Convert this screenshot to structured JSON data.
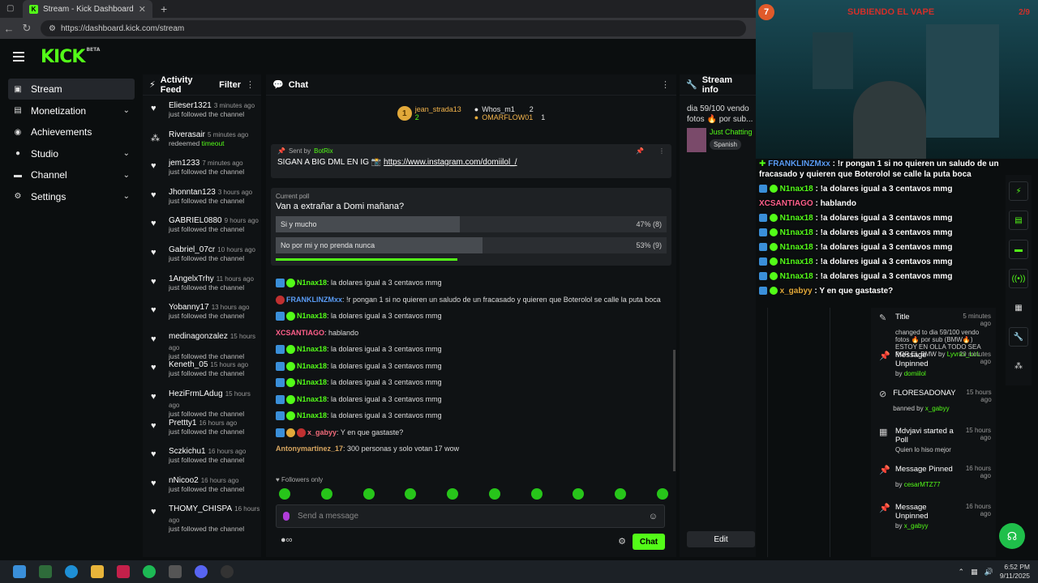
{
  "browser": {
    "tab_title": "Stream - Kick Dashboard",
    "url": "https://dashboard.kick.com/stream"
  },
  "header": {
    "logo": "KICK",
    "logo_badge": "BETA"
  },
  "sidebar": {
    "items": [
      {
        "label": "Stream",
        "icon": "stream-icon",
        "active": true
      },
      {
        "label": "Monetization",
        "icon": "monetization-icon",
        "chevron": true
      },
      {
        "label": "Achievements",
        "icon": "achievements-icon"
      },
      {
        "label": "Studio",
        "icon": "studio-icon",
        "chevron": true
      },
      {
        "label": "Channel",
        "icon": "channel-icon",
        "chevron": true
      },
      {
        "label": "Settings",
        "icon": "settings-icon",
        "chevron": true
      }
    ]
  },
  "activity": {
    "title": "Activity Feed",
    "filter": "Filter",
    "items": [
      {
        "user": "Elieser1321",
        "time": "3 minutes ago",
        "action": "just followed the channel"
      },
      {
        "user": "Riverasair",
        "time": "5 minutes ago",
        "action": "redeemed",
        "extra": "timeout"
      },
      {
        "user": "jem1233",
        "time": "7 minutes ago",
        "action": "just followed the channel"
      },
      {
        "user": "Jhonntan123",
        "time": "3 hours ago",
        "action": "just followed the channel"
      },
      {
        "user": "GABRIEL0880",
        "time": "9 hours ago",
        "action": "just followed the channel"
      },
      {
        "user": "Gabriel_07cr",
        "time": "10 hours ago",
        "action": "just followed the channel"
      },
      {
        "user": "1AngelxTrhy",
        "time": "11 hours ago",
        "action": "just followed the channel"
      },
      {
        "user": "Yobanny17",
        "time": "13 hours ago",
        "action": "just followed the channel"
      },
      {
        "user": "medinagonzalez",
        "time": "15 hours ago",
        "action": "just followed the channel"
      },
      {
        "user": "Keneth_05",
        "time": "15 hours ago",
        "action": "just followed the channel"
      },
      {
        "user": "HeziFrmLAdug",
        "time": "15 hours ago",
        "action": "just followed the channel"
      },
      {
        "user": "Prettty1",
        "time": "16 hours ago",
        "action": "just followed the channel"
      },
      {
        "user": "Sczkichu1",
        "time": "16 hours ago",
        "action": "just followed the channel"
      },
      {
        "user": "nNicoo2",
        "time": "16 hours ago",
        "action": "just followed the channel"
      },
      {
        "user": "THOMY_CHISPA",
        "time": "16 hours ago",
        "action": "just followed the channel"
      }
    ]
  },
  "chat": {
    "title": "Chat",
    "leaders": [
      {
        "rank": "1",
        "name": "jean_strada13",
        "count": "2"
      },
      {
        "name": "Whos_m1",
        "count": "2"
      },
      {
        "name": "OMARFLOW01",
        "count": "1"
      }
    ],
    "pinned": {
      "sent_by": "Sent by",
      "sender": "BotRix",
      "text": "SIGAN A BIG DML EN IG 📸",
      "link": "https://www.instagram.com/domiilol_/"
    },
    "poll": {
      "label": "Current poll",
      "question": "Van a extrañar a Domi mañana?",
      "options": [
        {
          "text": "Si y mucho",
          "pct": "47% (8)",
          "value": 47
        },
        {
          "text": "No por mi y no prenda nunca",
          "pct": "53% (9)",
          "value": 53
        }
      ]
    },
    "messages": [
      {
        "user": "N1nax18",
        "cls": "n-g",
        "badges": [
          "bd",
          "bd g"
        ],
        "text": "la dolares igual a 3 centavos mmg"
      },
      {
        "user": "FRANKLINZMxx",
        "cls": "n-b",
        "badges": [
          "bd r"
        ],
        "text": "!r pongan 1 si no quieren un saludo de un fracasado y quieren que Boterolol se calle la puta boca"
      },
      {
        "user": "N1nax18",
        "cls": "n-g",
        "badges": [
          "bd",
          "bd g"
        ],
        "text": "la dolares igual a 3 centavos mmg"
      },
      {
        "user": "XCSANTIAGO",
        "cls": "n-p",
        "badges": [],
        "text": "hablando"
      },
      {
        "user": "N1nax18",
        "cls": "n-g",
        "badges": [
          "bd",
          "bd g"
        ],
        "text": "la dolares igual a 3 centavos mmg"
      },
      {
        "user": "N1nax18",
        "cls": "n-g",
        "badges": [
          "bd",
          "bd g"
        ],
        "text": "la dolares igual a 3 centavos mmg"
      },
      {
        "user": "N1nax18",
        "cls": "n-g",
        "badges": [
          "bd",
          "bd g"
        ],
        "text": "la dolares igual a 3 centavos mmg"
      },
      {
        "user": "N1nax18",
        "cls": "n-g",
        "badges": [
          "bd",
          "bd g"
        ],
        "text": "la dolares igual a 3 centavos mmg"
      },
      {
        "user": "N1nax18",
        "cls": "n-g",
        "badges": [
          "bd",
          "bd g"
        ],
        "text": "la dolares igual a 3 centavos mmg"
      },
      {
        "user": "x_gabyy",
        "cls": "n-r",
        "badges": [
          "bd",
          "bd y",
          "bd r"
        ],
        "text": "Y en que gastaste?"
      },
      {
        "user": "Antonymartinez_17",
        "cls": "n-o",
        "badges": [],
        "text": "300 personas y solo votan 17 wow"
      }
    ],
    "followers_only": "Followers only",
    "input_placeholder": "Send a message",
    "send_label": "Chat"
  },
  "streaminfo": {
    "title": "Stream info",
    "stream_title": "dia 59/100 vendo fotos 🔥 por sub...",
    "category": "Just Chatting",
    "tag": "Spanish",
    "edit": "Edit"
  },
  "cam": {
    "level": "7",
    "goal": "SUBIENDO EL VAPE",
    "count": "2/9"
  },
  "overlay": [
    {
      "pre": "✚ ",
      "user": "FRANKLINZMxx",
      "cls": "nb",
      "text": "!r pongan 1 si no quieren un saludo de un fracasado y quieren que Boterolol se calle la puta boca"
    },
    {
      "user": "N1nax18",
      "cls": "ng",
      "text": "!a dolares igual a 3 centavos mmg",
      "b": true
    },
    {
      "user": "XCSANTIAGO",
      "cls": "nr",
      "text": "hablando"
    },
    {
      "user": "N1nax18",
      "cls": "ng",
      "text": "!a dolares igual a 3 centavos mmg",
      "b": true
    },
    {
      "user": "N1nax18",
      "cls": "ng",
      "text": "!a dolares igual a 3 centavos mmg",
      "b": true
    },
    {
      "user": "N1nax18",
      "cls": "ng",
      "text": "!a dolares igual a 3 centavos mmg",
      "b": true
    },
    {
      "user": "N1nax18",
      "cls": "ng",
      "text": "!a dolares igual a 3 centavos mmg",
      "b": true
    },
    {
      "user": "N1nax18",
      "cls": "ng",
      "text": "!a dolares igual a 3 centavos mmg",
      "b": true
    },
    {
      "user": "x_gabyy",
      "cls": "nx",
      "text": "Y en que gastaste?",
      "b": true
    }
  ],
  "modlog": [
    {
      "icon": "pencil-icon",
      "title": "Title",
      "time": "5 minutes ago",
      "sub": "changed to dia 59/100 vendo fotos 🔥 por sub (BMW🔥) ESTOY EN OLLA TODO SEA POR EL BMW by",
      "by": "Lyvrax_LoL"
    },
    {
      "icon": "pin-icon",
      "title": "Message Unpinned",
      "time": "29 minutes ago",
      "sub": "by",
      "by": "domiilol"
    },
    {
      "icon": "ban-icon",
      "title": "FLORESADONAY",
      "time": "15 hours ago",
      "sub": "banned by",
      "by": "x_gabyy"
    },
    {
      "icon": "poll-icon",
      "title": "Mdvjavi started a Poll",
      "time": "15 hours ago",
      "sub": "Quien lo hiso mejor",
      "by": ""
    },
    {
      "icon": "pin-icon",
      "title": "Message Pinned",
      "time": "16 hours ago",
      "sub": "by",
      "by": "cesarMTZ77"
    },
    {
      "icon": "pin-icon",
      "title": "Message Unpinned",
      "time": "16 hours ago",
      "sub": "by",
      "by": "x_gabyy"
    }
  ],
  "taskbar": {
    "time": "6:52 PM",
    "date": "9/11/2025"
  }
}
